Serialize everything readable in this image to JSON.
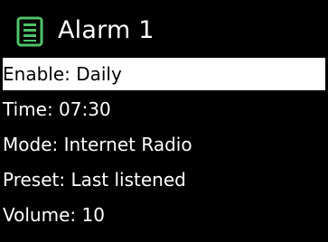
{
  "header": {
    "icon": "alarm-list-icon",
    "icon_color": "#4fc36a",
    "title": "Alarm 1"
  },
  "menu": {
    "selected_index": 0,
    "highlight_color": "#ffffff",
    "items": [
      {
        "label": "Enable: Daily"
      },
      {
        "label": "Time: 07:30"
      },
      {
        "label": "Mode: Internet Radio"
      },
      {
        "label": "Preset: Last listened"
      },
      {
        "label": "Volume: 10"
      }
    ]
  }
}
